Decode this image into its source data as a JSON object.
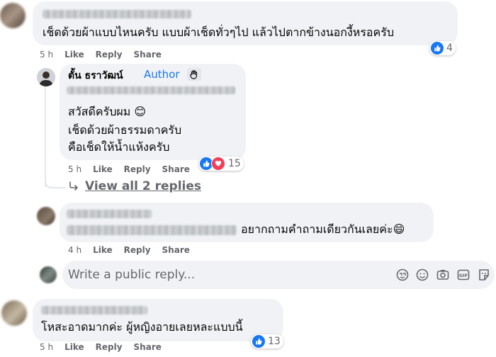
{
  "comment1": {
    "text": "เช็ดด้วยผ้าแบบไหนครับ แบบผ้าเช็ดทั่วๆไป แล้วไปตากข้างนอกงี้หรอครับ",
    "time": "5 h",
    "like": "Like",
    "reply": "Reply",
    "share": "Share",
    "reaction_count": "4"
  },
  "author_reply": {
    "name": "ตั้น ธราวัฒน์",
    "badge": "Author",
    "line1": "สวัสดีครับผม 😊",
    "line2": "เช็ดด้วยผ้าธรรมดาครับ",
    "line3": "คือเช็ดให้น้ำแห้งครับ",
    "time": "5 h",
    "like": "Like",
    "reply": "Reply",
    "share": "Share",
    "reaction_count": "15",
    "view_replies": "View all 2 replies"
  },
  "comment2": {
    "text": "อยากถามคำถามเดียวกันเลยค่ะ😄",
    "time": "4 h",
    "like": "Like",
    "reply": "Reply",
    "share": "Share"
  },
  "reply_box": {
    "placeholder": "Write a public reply..."
  },
  "comment3": {
    "text": "โหสะอาดมากค่ะ ผู้หญิงอายเลยหละแบบนี้",
    "time": "5 h",
    "like": "Like",
    "reply": "Reply",
    "share": "Share",
    "reaction_count": "13"
  },
  "colors": {
    "bubble": "#f0f2f5",
    "link_blue": "#1877f2",
    "meta_gray": "#65676b",
    "love_red": "#f33e58"
  }
}
